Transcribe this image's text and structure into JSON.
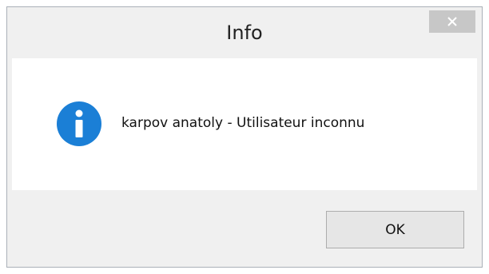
{
  "window": {
    "title": "Info",
    "close_icon": "close-icon"
  },
  "message": {
    "icon": "info-icon",
    "icon_color": "#1b7fd6",
    "text": "karpov anatoly - Utilisateur inconnu"
  },
  "buttons": {
    "ok_label": "OK"
  }
}
